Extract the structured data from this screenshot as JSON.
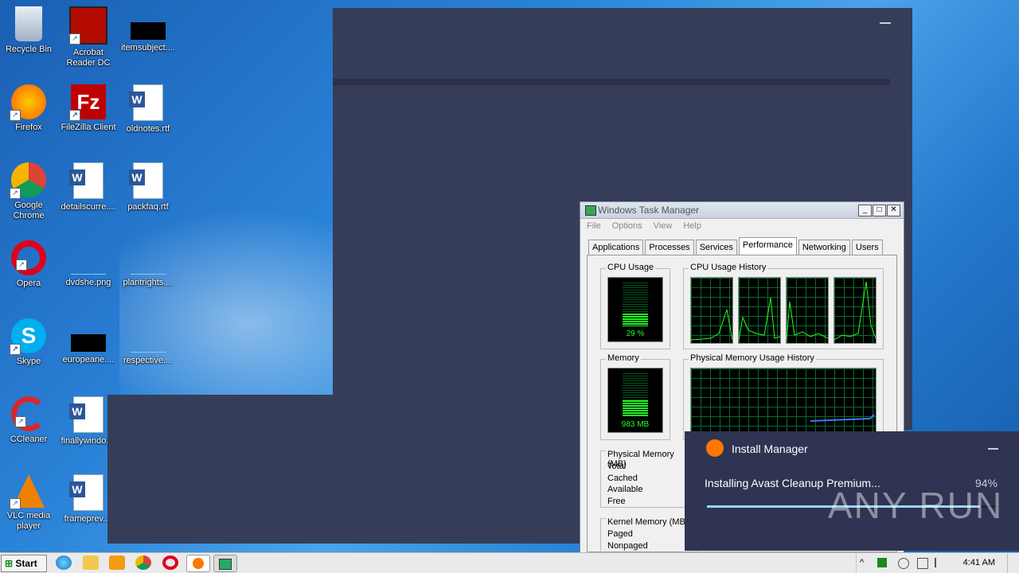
{
  "desktop": {
    "icons": [
      {
        "label": "Recycle Bin"
      },
      {
        "label": "Acrobat Reader DC"
      },
      {
        "label": "itemsubject...."
      },
      {
        "label": "Firefox"
      },
      {
        "label": "FileZilla Client"
      },
      {
        "label": "oldnotes.rtf"
      },
      {
        "label": "Google Chrome"
      },
      {
        "label": "detailscurre...."
      },
      {
        "label": "packfaq.rtf"
      },
      {
        "label": "Opera"
      },
      {
        "label": "dvdshe.png"
      },
      {
        "label": "plantrights...."
      },
      {
        "label": "Skype"
      },
      {
        "label": "europeane...."
      },
      {
        "label": "respective...."
      },
      {
        "label": "CCleaner"
      },
      {
        "label": "finallywindo...."
      },
      {
        "label": "VLC media player"
      },
      {
        "label": "frameprev...."
      }
    ]
  },
  "task_manager": {
    "title": "Windows Task Manager",
    "menu": [
      "File",
      "Options",
      "View",
      "Help"
    ],
    "tabs": [
      "Applications",
      "Processes",
      "Services",
      "Performance",
      "Networking",
      "Users"
    ],
    "active_tab": "Performance",
    "cpu_usage_label": "CPU Usage",
    "cpu_usage_value": "29 %",
    "cpu_usage_fraction": 0.29,
    "cpu_history_label": "CPU Usage History",
    "memory_label": "Memory",
    "memory_value": "983 MB",
    "memory_fraction": 0.38,
    "memory_history_label": "Physical Memory Usage History",
    "physical_memory_label": "Physical Memory (MB)",
    "physical_memory_rows": [
      "Total",
      "Cached",
      "Available",
      "Free"
    ],
    "kernel_memory_label": "Kernel Memory (MB)",
    "kernel_memory_rows": [
      "Paged",
      "Nonpaged"
    ]
  },
  "install_manager": {
    "title": "Install Manager",
    "status": "Installing Avast Cleanup Premium...",
    "percent_text": "94%",
    "progress": 0.94
  },
  "watermark": "ANY RUN",
  "taskbar": {
    "start_label": "Start",
    "clock": "4:41 AM"
  },
  "colors": {
    "panel_bg": "#363d58",
    "install_bg": "#2e3451",
    "avast_orange": "#ff7800",
    "meter_green": "#22ff22"
  }
}
